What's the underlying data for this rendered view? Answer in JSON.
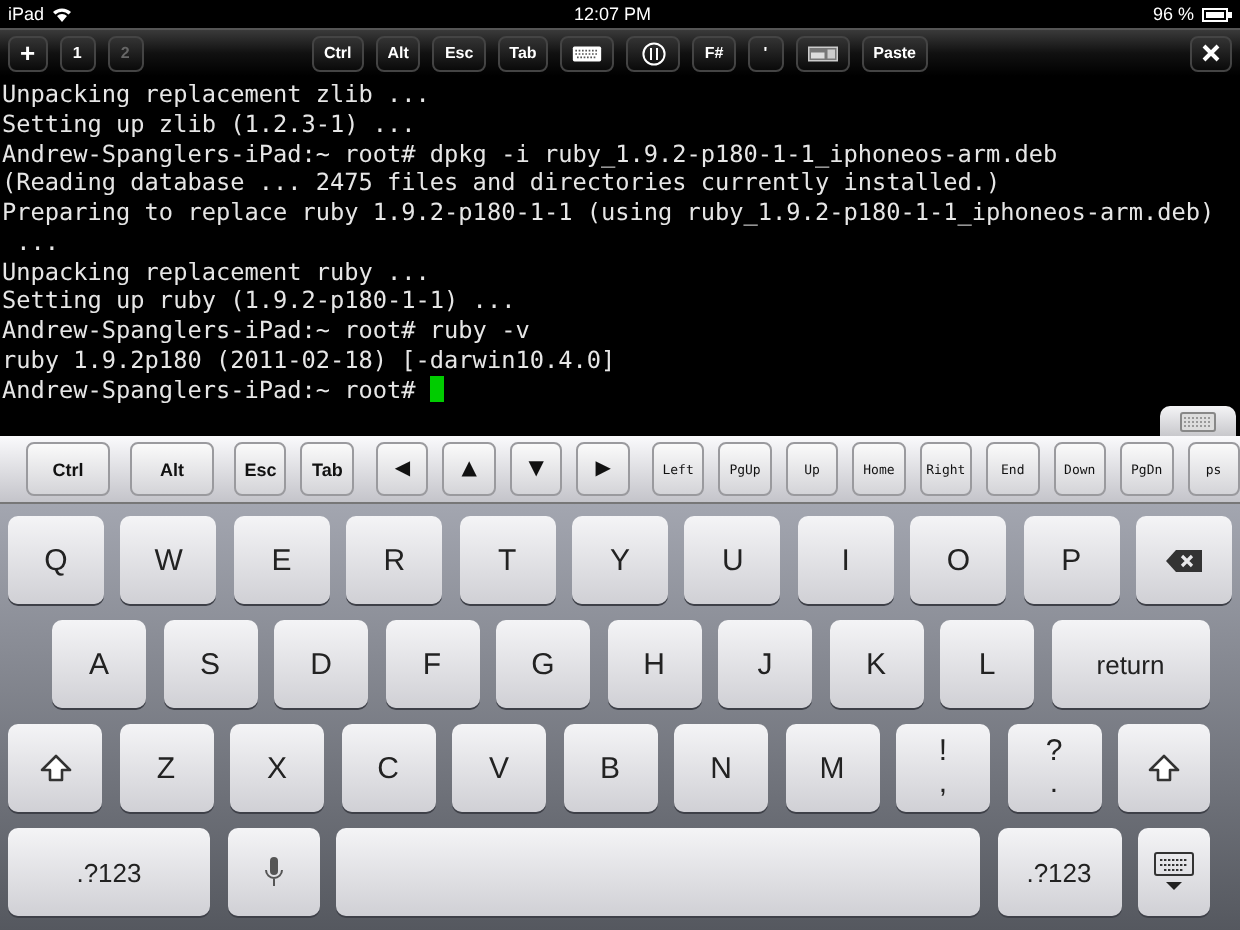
{
  "status_bar": {
    "device": "iPad",
    "time": "12:07 PM",
    "battery": "96 %"
  },
  "toolbar": {
    "new_tab": "+",
    "tabs": [
      {
        "label": "1",
        "selected": true
      },
      {
        "label": "2",
        "selected": false
      }
    ],
    "keys": [
      {
        "kind": "text",
        "label": "Ctrl"
      },
      {
        "kind": "text",
        "label": "Alt"
      },
      {
        "kind": "text",
        "label": "Esc"
      },
      {
        "kind": "text",
        "label": "Tab"
      },
      {
        "kind": "keyboard"
      },
      {
        "kind": "dial"
      },
      {
        "kind": "text",
        "label": "F#"
      },
      {
        "kind": "text",
        "label": "'"
      },
      {
        "kind": "panel"
      },
      {
        "kind": "text",
        "label": "Paste"
      }
    ]
  },
  "terminal": {
    "lines": [
      "Unpacking replacement zlib ...",
      "Setting up zlib (1.2.3-1) ...",
      "Andrew-Spanglers-iPad:~ root# dpkg -i ruby_1.9.2-p180-1-1_iphoneos-arm.deb",
      "(Reading database ... 2475 files and directories currently installed.)",
      "Preparing to replace ruby 1.9.2-p180-1-1 (using ruby_1.9.2-p180-1-1_iphoneos-arm.deb)",
      " ...",
      "Unpacking replacement ruby ...",
      "Setting up ruby (1.9.2-p180-1-1) ...",
      "Andrew-Spanglers-iPad:~ root# ruby -v",
      "ruby 1.9.2p180 (2011-02-18) [-darwin10.4.0]",
      "Andrew-Spanglers-iPad:~ root# "
    ],
    "cursor": true
  },
  "extra_keys": [
    {
      "kind": "bold",
      "label": "Ctrl"
    },
    {
      "kind": "bold",
      "label": "Alt"
    },
    {
      "kind": "bold",
      "label": "Esc"
    },
    {
      "kind": "bold",
      "label": "Tab"
    },
    {
      "kind": "arrow",
      "label": "◀"
    },
    {
      "kind": "arrow",
      "label": "▲"
    },
    {
      "kind": "arrow",
      "label": "▼"
    },
    {
      "kind": "arrow",
      "label": "▶"
    },
    {
      "kind": "mono",
      "label": "Left"
    },
    {
      "kind": "mono",
      "label": "PgUp"
    },
    {
      "kind": "mono",
      "label": "Up"
    },
    {
      "kind": "mono",
      "label": "Home"
    },
    {
      "kind": "mono",
      "label": "Right"
    },
    {
      "kind": "mono",
      "label": "End"
    },
    {
      "kind": "mono",
      "label": "Down"
    },
    {
      "kind": "mono",
      "label": "PgDn"
    },
    {
      "kind": "mono",
      "label": "ps"
    }
  ],
  "keyboard": {
    "rows": [
      {
        "keys": [
          {
            "kind": "letter",
            "label": "Q"
          },
          {
            "kind": "letter",
            "label": "W"
          },
          {
            "kind": "letter",
            "label": "E"
          },
          {
            "kind": "letter",
            "label": "R"
          },
          {
            "kind": "letter",
            "label": "T"
          },
          {
            "kind": "letter",
            "label": "Y"
          },
          {
            "kind": "letter",
            "label": "U"
          },
          {
            "kind": "letter",
            "label": "I"
          },
          {
            "kind": "letter",
            "label": "O"
          },
          {
            "kind": "letter",
            "label": "P"
          },
          {
            "kind": "backspace"
          }
        ]
      },
      {
        "keys": [
          {
            "kind": "letter",
            "label": "A"
          },
          {
            "kind": "letter",
            "label": "S"
          },
          {
            "kind": "letter",
            "label": "D"
          },
          {
            "kind": "letter",
            "label": "F"
          },
          {
            "kind": "letter",
            "label": "G"
          },
          {
            "kind": "letter",
            "label": "H"
          },
          {
            "kind": "letter",
            "label": "J"
          },
          {
            "kind": "letter",
            "label": "K"
          },
          {
            "kind": "letter",
            "label": "L"
          },
          {
            "kind": "return",
            "label": "return"
          }
        ]
      },
      {
        "keys": [
          {
            "kind": "shift"
          },
          {
            "kind": "letter",
            "label": "Z"
          },
          {
            "kind": "letter",
            "label": "X"
          },
          {
            "kind": "letter",
            "label": "C"
          },
          {
            "kind": "letter",
            "label": "V"
          },
          {
            "kind": "letter",
            "label": "B"
          },
          {
            "kind": "letter",
            "label": "N"
          },
          {
            "kind": "letter",
            "label": "M"
          },
          {
            "kind": "punct",
            "top": "!",
            "bottom": ","
          },
          {
            "kind": "punct",
            "top": "?",
            "bottom": "."
          },
          {
            "kind": "shift"
          }
        ]
      },
      {
        "keys": [
          {
            "kind": "numbers",
            "label": ".?123"
          },
          {
            "kind": "mic"
          },
          {
            "kind": "space"
          },
          {
            "kind": "numbers",
            "label": ".?123"
          },
          {
            "kind": "hide"
          }
        ]
      }
    ]
  }
}
